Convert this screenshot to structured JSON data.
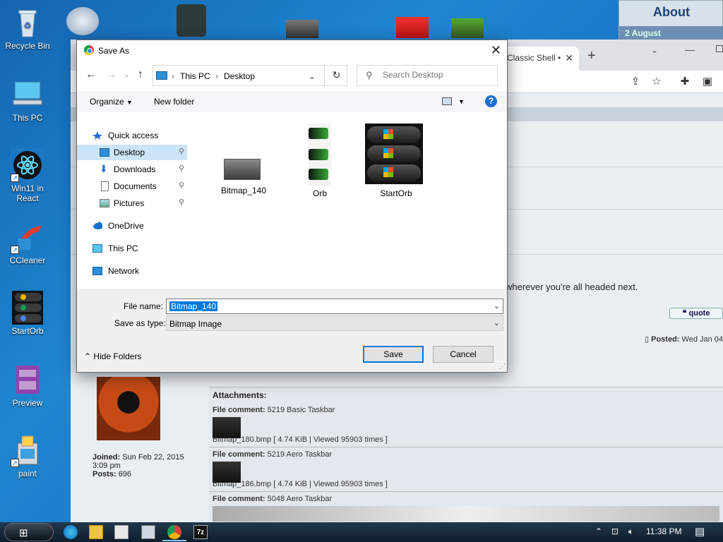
{
  "desktop": {
    "icons": [
      {
        "label": "Recycle Bin"
      },
      {
        "label": "This PC"
      },
      {
        "label": "Win11 in React"
      },
      {
        "label": "CCleaner"
      },
      {
        "label": "StartOrb"
      },
      {
        "label": "Preview"
      },
      {
        "label": "paint"
      }
    ]
  },
  "about_widget": {
    "title": "About",
    "date": "2 August"
  },
  "browser": {
    "tab_title": "Classic Shell •",
    "forum_text": "wherever you're all headed next.",
    "quote_label": "quote",
    "posted_label": "Posted:",
    "posted_value": "Wed Jan 04",
    "user_joined_label": "Joined:",
    "user_joined_value": "Sun Feb 22, 2015",
    "user_joined_time": "3:09 pm",
    "user_posts_label": "Posts:",
    "user_posts_value": "696",
    "attachments_title": "Attachments:",
    "attachments": [
      {
        "comment_label": "File comment:",
        "comment": "5219 Basic Taskbar",
        "file": "Bitmap_180.bmp [ 4.74 KiB | Viewed 95903 times ]"
      },
      {
        "comment_label": "File comment:",
        "comment": "5219 Aero Taskbar",
        "file": "Bitmap_186.bmp [ 4.74 KiB | Viewed 95903 times ]"
      },
      {
        "comment_label": "File comment:",
        "comment": "5048 Aero Taskbar",
        "file": ""
      }
    ]
  },
  "dialog": {
    "title": "Save As",
    "breadcrumb": [
      "This PC",
      "Desktop"
    ],
    "search_placeholder": "Search Desktop",
    "organize_label": "Organize",
    "new_folder_label": "New folder",
    "nav_items": [
      {
        "label": "Quick access",
        "pinned": false
      },
      {
        "label": "Desktop",
        "pinned": true
      },
      {
        "label": "Downloads",
        "pinned": true
      },
      {
        "label": "Documents",
        "pinned": true
      },
      {
        "label": "Pictures",
        "pinned": true
      },
      {
        "label": "OneDrive",
        "pinned": false
      },
      {
        "label": "This PC",
        "pinned": false
      },
      {
        "label": "Network",
        "pinned": false
      }
    ],
    "files": [
      {
        "name": "Bitmap_140"
      },
      {
        "name": "Orb"
      },
      {
        "name": "StartOrb"
      }
    ],
    "file_name_label": "File name:",
    "file_name_value": "Bitmap_140",
    "save_as_type_label": "Save as type:",
    "save_as_type_value": "Bitmap Image",
    "hide_folders_label": "Hide Folders",
    "save_label": "Save",
    "cancel_label": "Cancel"
  },
  "taskbar": {
    "clock": "11:38 PM"
  },
  "colors": {
    "accent": "#0078d7",
    "selection": "#cce4f7"
  }
}
